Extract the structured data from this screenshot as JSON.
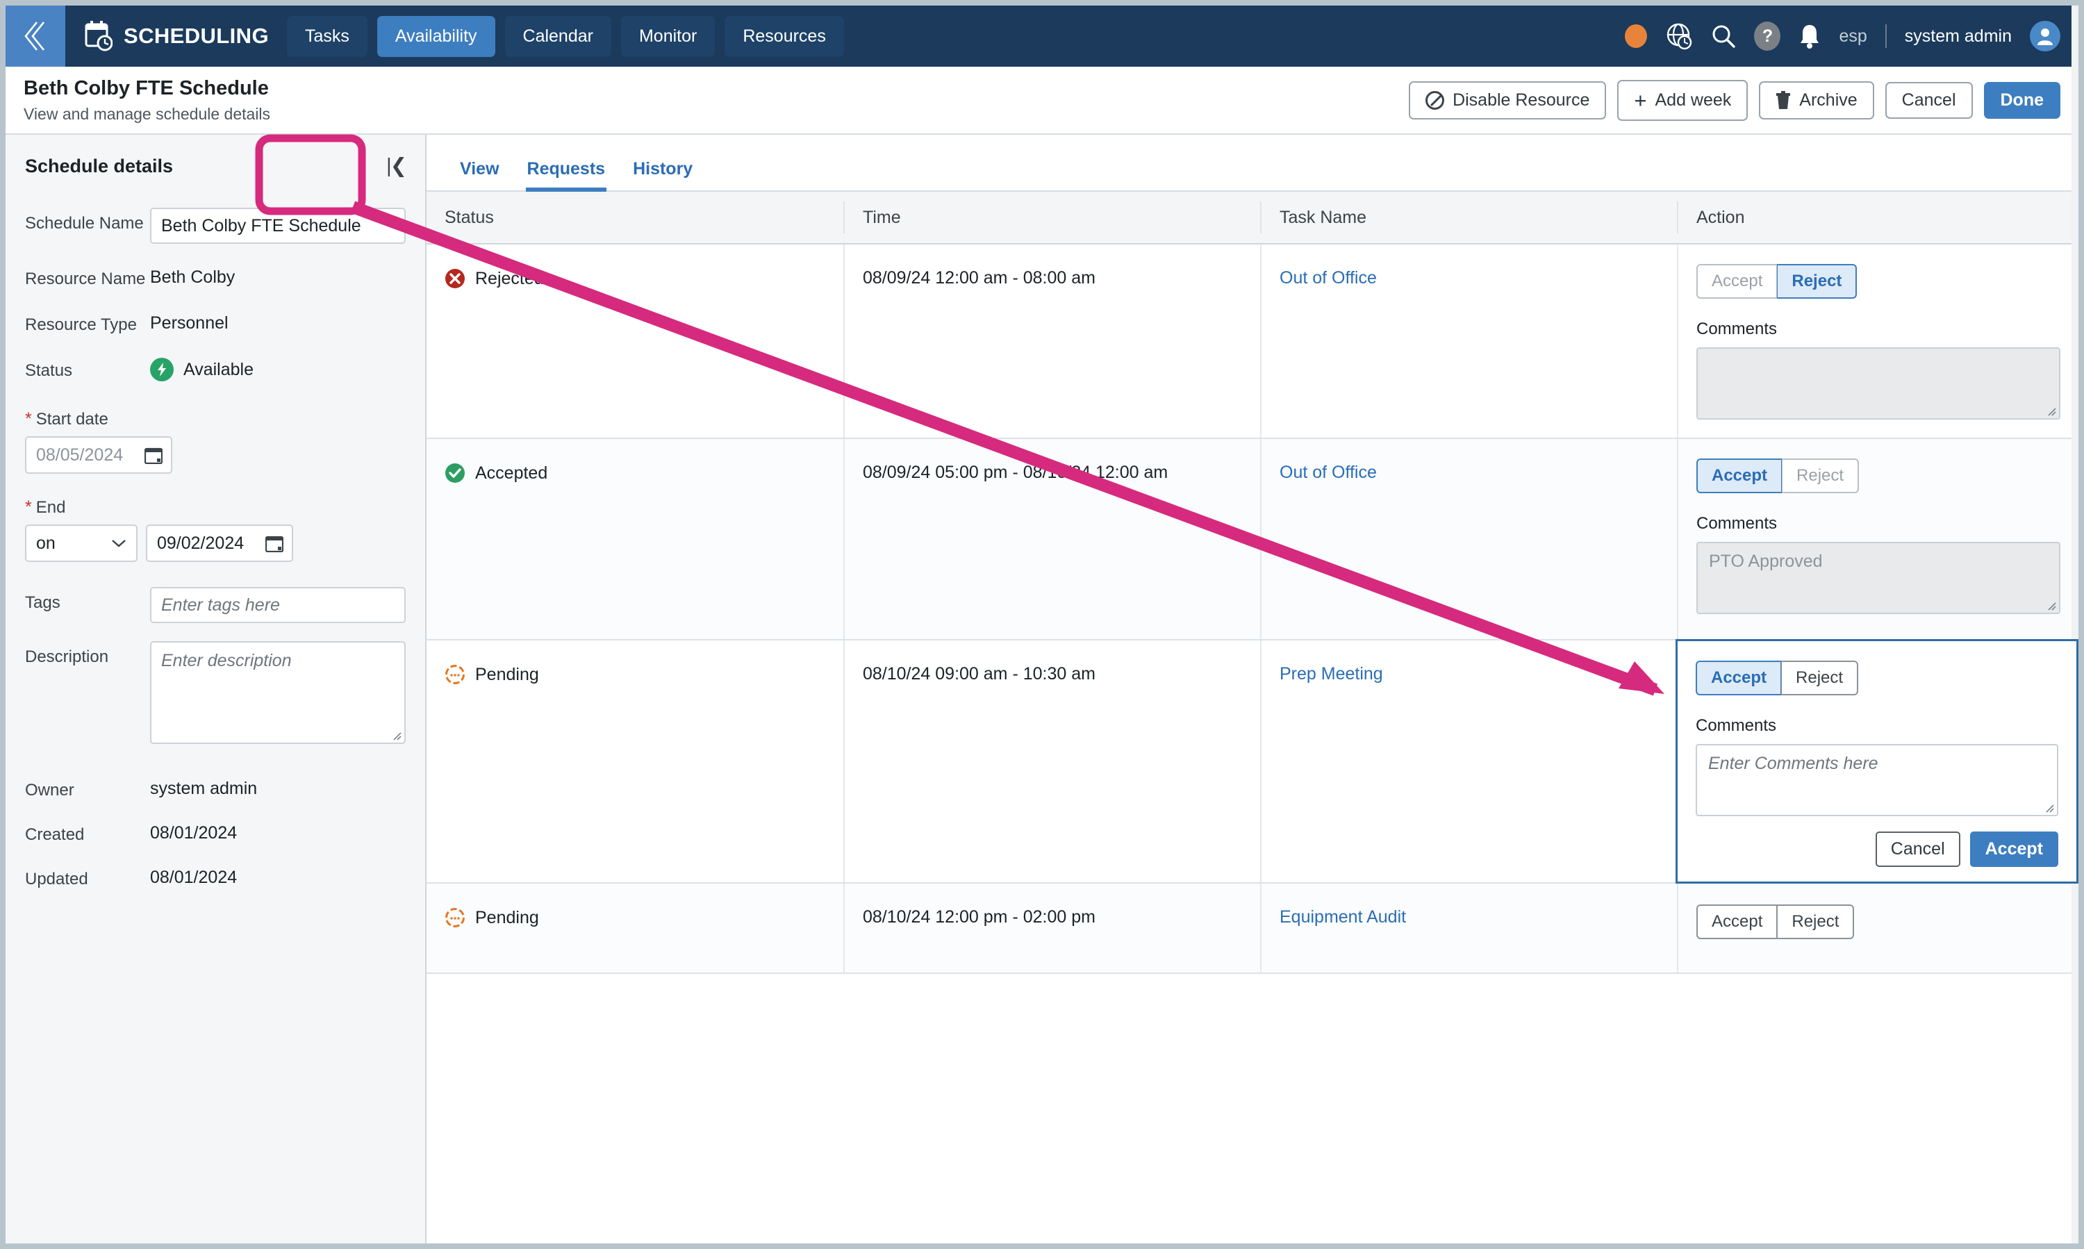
{
  "topnav": {
    "back_icon": "chevron-double-left-icon",
    "app_icon": "calendar-clock-icon",
    "brand": "SCHEDULING",
    "items": [
      {
        "label": "Tasks",
        "active": false
      },
      {
        "label": "Availability",
        "active": true
      },
      {
        "label": "Calendar",
        "active": false
      },
      {
        "label": "Monitor",
        "active": false
      },
      {
        "label": "Resources",
        "active": false
      }
    ],
    "right": {
      "status_dot": "orange-status-dot",
      "globe_icon": "globe-clock-icon",
      "search_icon": "search-icon",
      "help_icon": "help-question-icon",
      "bell_icon": "notification-bell-icon",
      "language": "esp",
      "user": "system admin",
      "avatar_icon": "user-avatar-icon"
    }
  },
  "pageheader": {
    "title": "Beth Colby FTE Schedule",
    "subtitle": "View and manage schedule details",
    "actions": [
      {
        "label": "Disable Resource",
        "icon": "ban-icon",
        "primary": false
      },
      {
        "label": "Add week",
        "icon": "plus-icon",
        "primary": false
      },
      {
        "label": "Archive",
        "icon": "trash-icon",
        "primary": false
      },
      {
        "label": "Cancel",
        "icon": "",
        "primary": false
      },
      {
        "label": "Done",
        "icon": "",
        "primary": true
      }
    ]
  },
  "sidebar": {
    "title": "Schedule details",
    "collapse_icon": "collapse-panel-icon",
    "schedule_name_label": "Schedule Name",
    "schedule_name_value": "Beth Colby FTE Schedule",
    "resource_name_label": "Resource Name",
    "resource_name_value": "Beth Colby",
    "resource_type_label": "Resource Type",
    "resource_type_value": "Personnel",
    "status_label": "Status",
    "status_value": "Available",
    "status_icon": "available-bolt-icon",
    "start_date_label": "Start date",
    "start_date_value": "08/05/2024",
    "start_date_required": "*",
    "end_label": "End",
    "end_required": "*",
    "end_mode_value": "on",
    "end_date_value": "09/02/2024",
    "calendar_icon": "calendar-icon",
    "tags_label": "Tags",
    "tags_placeholder": "Enter tags here",
    "description_label": "Description",
    "description_placeholder": "Enter description",
    "owner_label": "Owner",
    "owner_value": "system admin",
    "created_label": "Created",
    "created_value": "08/01/2024",
    "updated_label": "Updated",
    "updated_value": "08/01/2024"
  },
  "main": {
    "tabs": [
      {
        "label": "View",
        "active": false
      },
      {
        "label": "Requests",
        "active": true
      },
      {
        "label": "History",
        "active": false
      }
    ],
    "table": {
      "columns": [
        "Status",
        "Time",
        "Task Name",
        "Action"
      ],
      "rows": [
        {
          "status": "Rejected",
          "status_icon": "rejected-x-icon",
          "time": "08/09/24 12:00 am - 08:00 am",
          "task": "Out of Office",
          "accept_label": "Accept",
          "reject_label": "Reject",
          "selected": "reject",
          "comments_label": "Comments",
          "comments_value": "",
          "editing": false
        },
        {
          "status": "Accepted",
          "status_icon": "accepted-check-icon",
          "time": "08/09/24 05:00 pm - 08/10/24 12:00 am",
          "task": "Out of Office",
          "accept_label": "Accept",
          "reject_label": "Reject",
          "selected": "accept",
          "comments_label": "Comments",
          "comments_value": "PTO Approved",
          "editing": false
        },
        {
          "status": "Pending",
          "status_icon": "pending-dots-icon",
          "time": "08/10/24 09:00 am - 10:30 am",
          "task": "Prep Meeting",
          "accept_label": "Accept",
          "reject_label": "Reject",
          "selected": "accept",
          "comments_label": "Comments",
          "comments_placeholder": "Enter Comments here",
          "cancel_label": "Cancel",
          "confirm_label": "Accept",
          "editing": true
        },
        {
          "status": "Pending",
          "status_icon": "pending-dots-icon",
          "time": "08/10/24 12:00 pm - 02:00 pm",
          "task": "Equipment Audit",
          "accept_label": "Accept",
          "reject_label": "Reject",
          "selected": "none",
          "editing": false
        }
      ]
    }
  },
  "annotation": {
    "highlight_color": "#d62a7e",
    "shape": "rounded-rect-around-requests-tab-with-arrow-to-pending-action-cell"
  }
}
